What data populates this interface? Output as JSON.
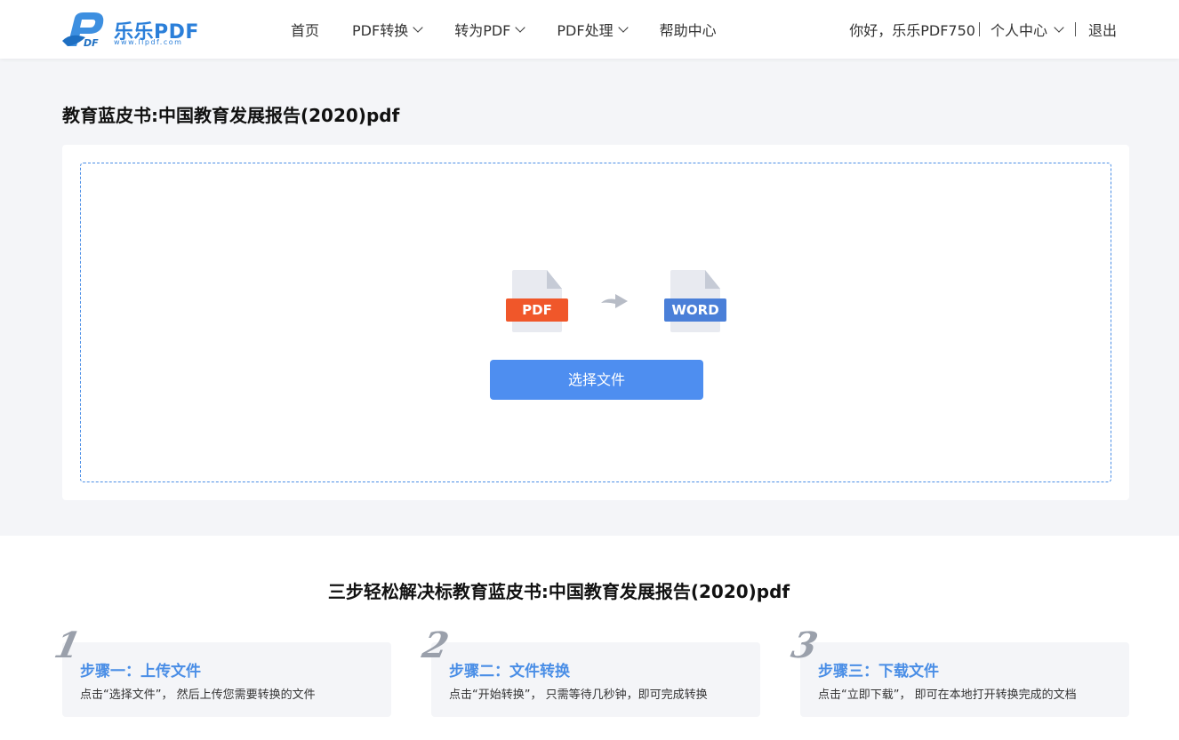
{
  "header": {
    "logo_text": "乐乐PDF",
    "logo_url": "www.llpdf.com",
    "nav": [
      {
        "label": "首页",
        "has_dropdown": false
      },
      {
        "label": "PDF转换",
        "has_dropdown": true
      },
      {
        "label": "转为PDF",
        "has_dropdown": true
      },
      {
        "label": "PDF处理",
        "has_dropdown": true
      },
      {
        "label": "帮助中心",
        "has_dropdown": false
      }
    ],
    "greeting": "你好，乐乐PDF750",
    "user_center": "个人中心",
    "logout": "退出"
  },
  "page": {
    "title": "教育蓝皮书:中国教育发展报告(2020)pdf"
  },
  "upload": {
    "from_label": "PDF",
    "to_label": "WORD",
    "select_button": "选择文件",
    "icons": [
      "pdf-file-icon",
      "arrow-right-icon",
      "word-file-icon"
    ]
  },
  "steps": {
    "title": "三步轻松解决标教育蓝皮书:中国教育发展报告(2020)pdf",
    "items": [
      {
        "num": "1",
        "title": "步骤一：上传文件",
        "desc": "点击“选择文件”， 然后上传您需要转换的文件"
      },
      {
        "num": "2",
        "title": "步骤二：文件转换",
        "desc": "点击“开始转换”， 只需等待几秒钟，即可完成转换"
      },
      {
        "num": "3",
        "title": "步骤三：下载文件",
        "desc": "点击“立即下载”， 即可在本地打开转换完成的文档"
      }
    ]
  },
  "colors": {
    "accent": "#4e8ef0",
    "pdf": "#f0572a",
    "word": "#4a7fd8",
    "background": "#f4f5f8"
  }
}
